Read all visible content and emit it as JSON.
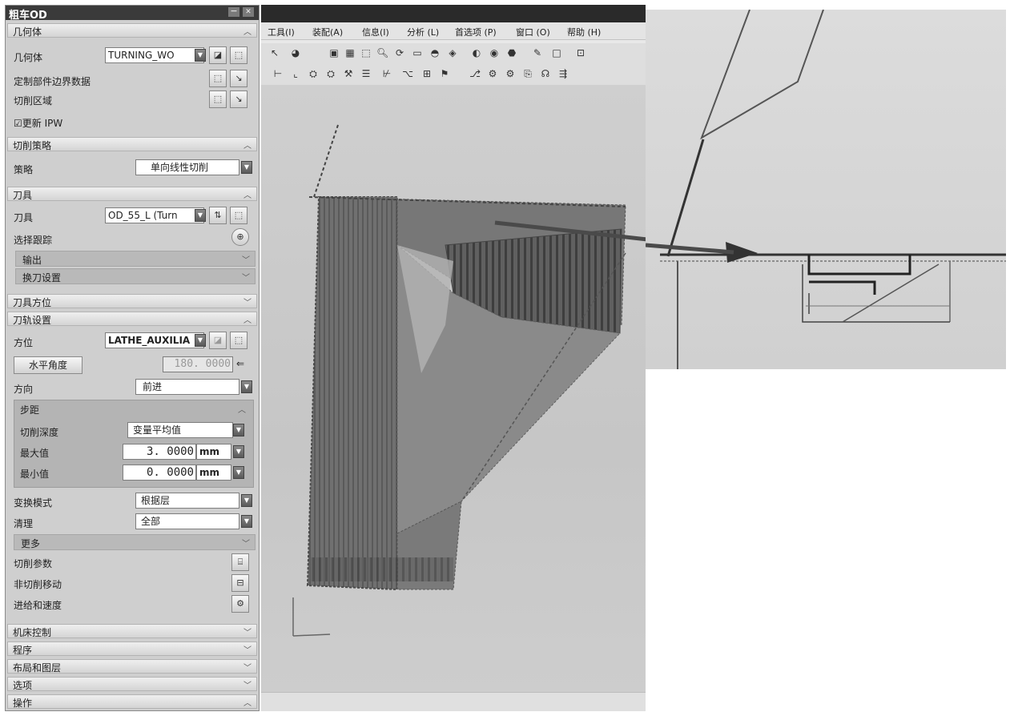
{
  "dialog": {
    "title": "粗车OD",
    "title_buttons": [
      "－",
      "✕"
    ],
    "sections": {
      "geometry": {
        "header": "几何体",
        "geometry_label": "几何体",
        "geometry_value": "TURNING_WO",
        "custom_boundary": "定制部件边界数据",
        "cut_region": "切削区域",
        "update_ipw": "☑更新 IPW"
      },
      "strategy": {
        "header": "切削策略",
        "strategy_label": "策略",
        "strategy_value": "单向线性切削"
      },
      "tool": {
        "header": "刀具",
        "tool_label": "刀具",
        "tool_value": "OD_55_L (Turn",
        "tracking_label": "选择跟踪",
        "output": "输出",
        "tool_change": "换刀设置"
      },
      "tool_orient": {
        "header": "刀具方位"
      },
      "path": {
        "header": "刀轨设置",
        "orient_label": "方位",
        "orient_value": "LATHE_AUXILIA",
        "horiz_angle_button": "水平角度",
        "horiz_angle_value": "180. 0000",
        "direction_label": "方向",
        "direction_value": "前进",
        "step": {
          "header": "步距",
          "depth_label": "切削深度",
          "depth_value": "变量平均值",
          "max_label": "最大值",
          "max_value": "3. 0000",
          "max_unit": "mm",
          "min_label": "最小值",
          "min_value": "0. 0000",
          "min_unit": "mm"
        },
        "transform_label": "变换模式",
        "transform_value": "根据层",
        "cleanup_label": "清理",
        "cleanup_value": "全部",
        "more": "更多",
        "cut_params": "切削参数",
        "non_cut": "非切削移动",
        "feeds": "进给和速度"
      },
      "machine_ctrl": {
        "header": "机床控制"
      },
      "program": {
        "header": "程序"
      },
      "layout": {
        "header": "布局和图层"
      },
      "options": {
        "header": "选项"
      },
      "actions": {
        "header": "操作"
      }
    }
  },
  "menubar": [
    "工具(I)",
    "装配(A)",
    "信息(I)",
    "分析 (L)",
    "首选项 (P)",
    "窗口 (O)",
    "帮助 (H)"
  ],
  "toolbar_icons": [
    "select-icon",
    "view-icon",
    "fit-icon",
    "zoom-icon",
    "rotate-icon",
    "shade-icon",
    "wireframe-icon",
    "layer-icon"
  ],
  "colors": {
    "title_bar": "#3a3a3a",
    "section_bg": "#e2e2e2",
    "viewport_bg": "#cbcbcb",
    "toolpath_dark": "#5a5a5a",
    "arrow": "#4a4a4a"
  }
}
